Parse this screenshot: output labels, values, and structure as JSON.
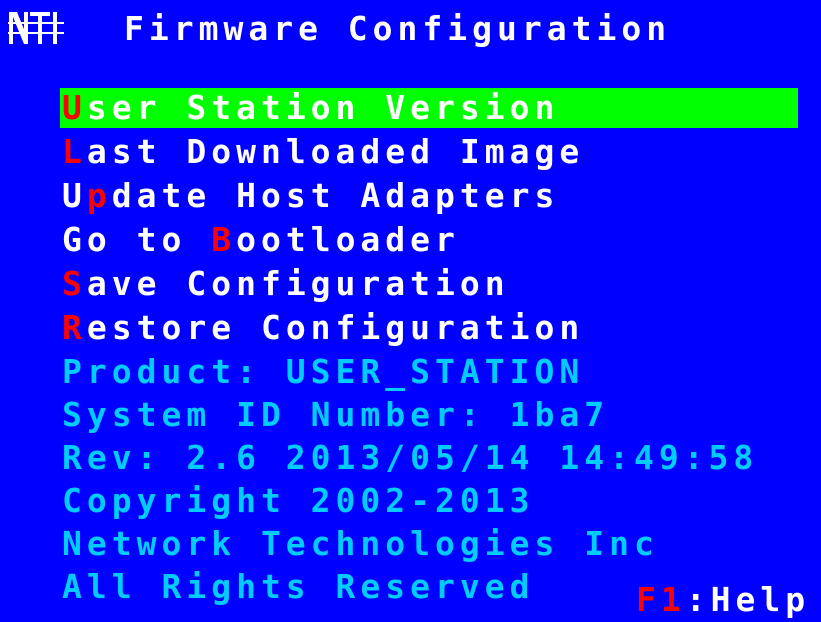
{
  "title": {
    "logo": "NTI",
    "text": "Firmware Configuration"
  },
  "menu": [
    {
      "hot": "U",
      "rest": "ser Station Version",
      "selected": true
    },
    {
      "hot": "L",
      "rest": "ast Downloaded Image"
    },
    {
      "pre": "U",
      "hot": "p",
      "rest": "date Host Adapters"
    },
    {
      "pre": "Go to ",
      "hot": "B",
      "rest": "ootloader"
    },
    {
      "hot": "S",
      "rest": "ave Configuration"
    },
    {
      "hot": "R",
      "rest": "estore Configuration"
    }
  ],
  "info": {
    "product": "Product: USER_STATION",
    "system_id": "System ID Number: 1ba7",
    "rev": "Rev: 2.6 2013/05/14 14:49:58",
    "copyright": "Copyright 2002-2013",
    "company": "Network Technologies Inc",
    "rights": "All Rights Reserved"
  },
  "help": {
    "key": "F1",
    "sep": ":",
    "label": "Help"
  },
  "colors": {
    "background": "#0000ff",
    "menu_text": "#ffffff",
    "hotkey": "#ff0000",
    "selection": "#00ff00",
    "info_text": "#00ccff"
  }
}
